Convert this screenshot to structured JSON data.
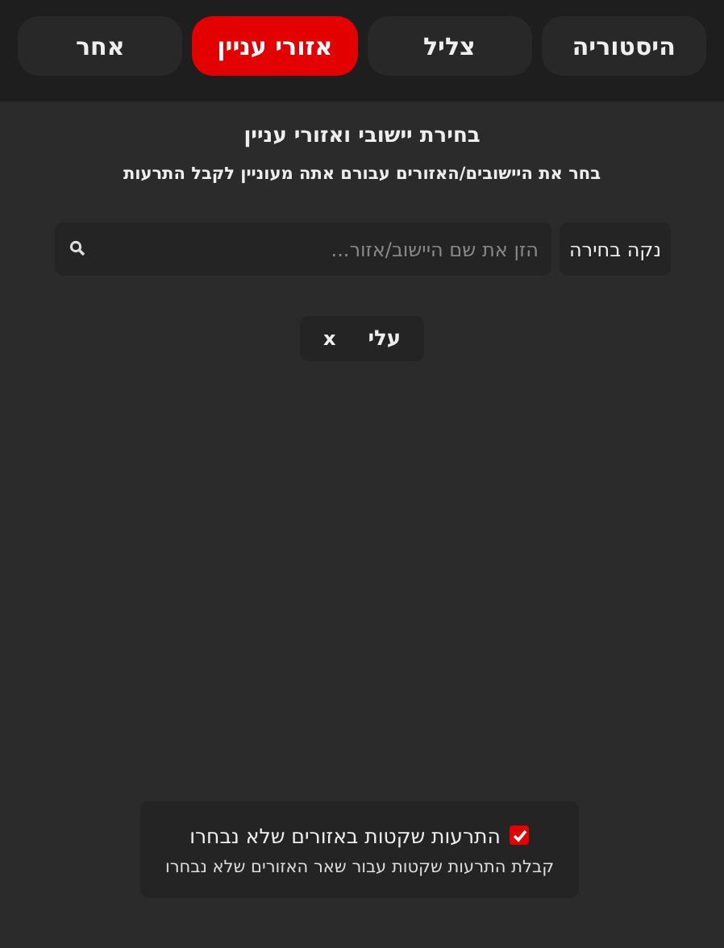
{
  "tabs": [
    {
      "label": "היסטוריה",
      "selected": false
    },
    {
      "label": "צליל",
      "selected": false
    },
    {
      "label": "אזורי עניין",
      "selected": true
    },
    {
      "label": "אחר",
      "selected": false
    }
  ],
  "section": {
    "title": "בחירת יישובי ואזורי עניין",
    "subtitle": "בחר את היישובים/האזורים עבורם אתה מעוניין לקבל התרעות"
  },
  "clear_button": "נקה בחירה",
  "search": {
    "placeholder": "הזן את שם היישוב/אזור..."
  },
  "chips": [
    {
      "label": "עלי",
      "remove": "x"
    }
  ],
  "option": {
    "label": "התרעות שקטות באזורים שלא נבחרו",
    "description": "קבלת התרעות שקטות עבור שאר האזורים שלא נבחרו",
    "checked": true
  }
}
